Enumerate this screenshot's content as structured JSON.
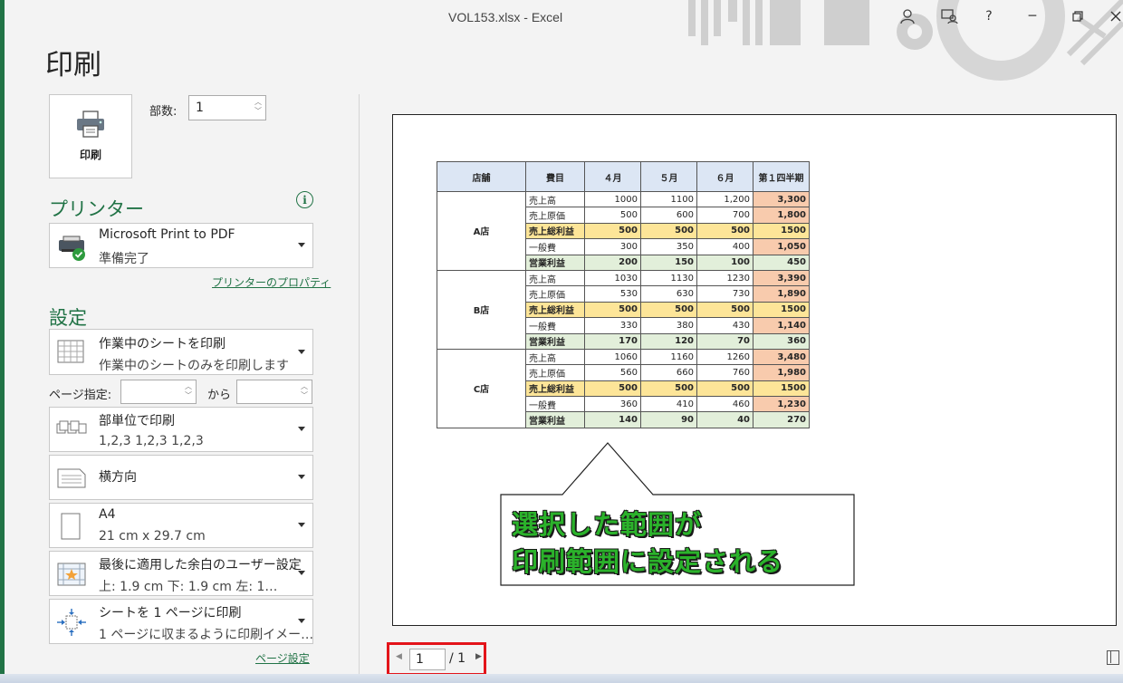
{
  "window": {
    "title": "VOL153.xlsx  -  Excel",
    "help": "?",
    "minimize": "─"
  },
  "page": {
    "heading": "印刷"
  },
  "print": {
    "button_label": "印刷",
    "copies_label": "部数:",
    "copies_value": "1"
  },
  "printer": {
    "section_title": "プリンター",
    "name": "Microsoft Print to PDF",
    "status": "準備完了",
    "properties_link": "プリンターのプロパティ"
  },
  "settings": {
    "section_title": "設定",
    "scope": {
      "title": "作業中のシートを印刷",
      "subtitle": "作業中のシートのみを印刷します"
    },
    "pages_label": "ページ指定:",
    "pages_from": "",
    "pages_to_label": "から",
    "pages_to": "",
    "collate": {
      "title": "部単位で印刷",
      "subtitle": "1,2,3    1,2,3    1,2,3"
    },
    "orientation": {
      "title": "横方向"
    },
    "paper": {
      "title": "A4",
      "subtitle": "21 cm x 29.7 cm"
    },
    "margins": {
      "title": "最後に適用した余白のユーザー設定",
      "subtitle": "上: 1.9 cm 下: 1.9 cm 左: 1…"
    },
    "scaling": {
      "title": "シートを 1 ページに印刷",
      "subtitle": "1 ページに収まるように印刷イメー…"
    },
    "page_setup_link": "ページ設定"
  },
  "sheet": {
    "headers": [
      "店舗",
      "費目",
      "４月",
      "５月",
      "６月",
      "第１四半期"
    ],
    "stores": [
      {
        "name": "A店",
        "rows": [
          [
            "売上高",
            "1000",
            "1100",
            "1,200",
            "3,300"
          ],
          [
            "売上原価",
            "500",
            "600",
            "700",
            "1,800"
          ],
          [
            "売上総利益",
            "500",
            "500",
            "500",
            "1500"
          ],
          [
            "一般費",
            "300",
            "350",
            "400",
            "1,050"
          ],
          [
            "営業利益",
            "200",
            "150",
            "100",
            "450"
          ]
        ]
      },
      {
        "name": "B店",
        "rows": [
          [
            "売上高",
            "1030",
            "1130",
            "1230",
            "3,390"
          ],
          [
            "売上原価",
            "530",
            "630",
            "730",
            "1,890"
          ],
          [
            "売上総利益",
            "500",
            "500",
            "500",
            "1500"
          ],
          [
            "一般費",
            "330",
            "380",
            "430",
            "1,140"
          ],
          [
            "営業利益",
            "170",
            "120",
            "70",
            "360"
          ]
        ]
      },
      {
        "name": "C店",
        "rows": [
          [
            "売上高",
            "1060",
            "1160",
            "1260",
            "3,480"
          ],
          [
            "売上原価",
            "560",
            "660",
            "760",
            "1,980"
          ],
          [
            "売上総利益",
            "500",
            "500",
            "500",
            "1500"
          ],
          [
            "一般費",
            "360",
            "410",
            "460",
            "1,230"
          ],
          [
            "営業利益",
            "140",
            "90",
            "40",
            "270"
          ]
        ]
      }
    ]
  },
  "callout": {
    "line1": "選択した範囲が",
    "line2": "印刷範囲に設定される"
  },
  "pager": {
    "current": "1",
    "total": "/ 1",
    "prev": "◀",
    "next": "▶"
  }
}
